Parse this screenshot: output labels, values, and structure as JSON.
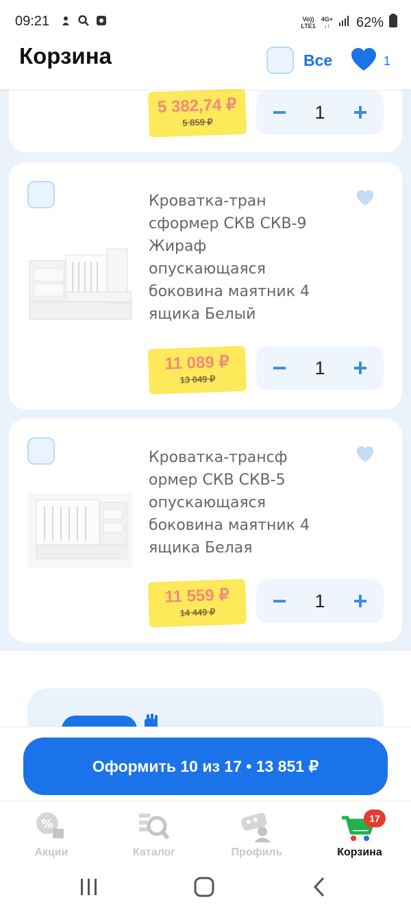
{
  "status_bar": {
    "time": "09:21",
    "network_top": "Vo))",
    "network_bottom": "LTE1",
    "net4g": "4G+",
    "battery": "62%"
  },
  "header": {
    "title": "Корзина",
    "select_all_label": "Все",
    "favorites_count": "1"
  },
  "cart_items": [
    {
      "price_new": "5 382,74 ₽",
      "price_old": "5 859 ₽",
      "qty": "1",
      "minus": "−",
      "plus": "+"
    },
    {
      "name": "Кроватка-тран сформер СКВ СКВ-9 Жираф опускающаяся боковина маятник 4 ящика Белый",
      "price_new": "11 089 ₽",
      "price_old": "13 049 ₽",
      "qty": "1",
      "minus": "−",
      "plus": "+"
    },
    {
      "name": "Кроватка-трансф ормер СКВ СКВ-5 опускающаяся боковина маятник 4 ящика Белая",
      "price_new": "11 559 ₽",
      "price_old": "14 449 ₽",
      "qty": "1",
      "minus": "−",
      "plus": "+"
    }
  ],
  "checkout": {
    "label": "Оформить 10 из 17 • 13 851 ₽"
  },
  "bottom_nav": [
    {
      "label": "Акции",
      "icon": "discount-icon",
      "active": false
    },
    {
      "label": "Каталог",
      "icon": "catalog-search-icon",
      "active": false
    },
    {
      "label": "Профиль",
      "icon": "profile-icon",
      "active": false
    },
    {
      "label": "Корзина",
      "icon": "cart-icon",
      "active": true,
      "badge": "17"
    }
  ],
  "colors": {
    "accent": "#1a73e8",
    "price_tag": "#fde95a",
    "price_text": "#f08a7e",
    "page_bg": "#eaf3fc",
    "badge": "#e8392f"
  }
}
